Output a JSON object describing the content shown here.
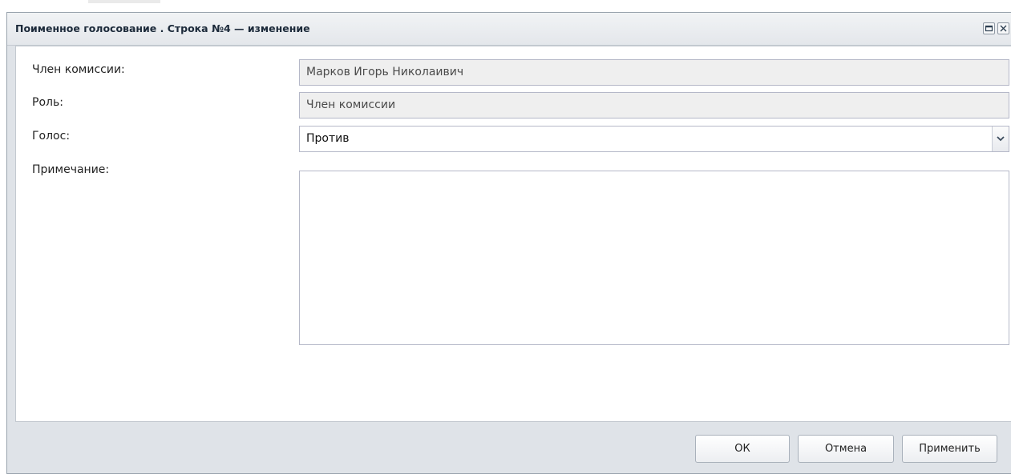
{
  "window": {
    "title": "Поименное голосование . Строка №4 — изменение"
  },
  "form": {
    "member": {
      "label": "Член комиссии:",
      "value": "Марков Игорь Николаивич"
    },
    "role": {
      "label": "Роль:",
      "value": "Член комиссии"
    },
    "vote": {
      "label": "Голос:",
      "value": "Против"
    },
    "note": {
      "label": "Примечание:",
      "value": ""
    }
  },
  "buttons": {
    "ok": "ОК",
    "cancel": "Отмена",
    "apply": "Применить"
  },
  "icons": {
    "maximize": "maximize-icon",
    "close": "close-icon",
    "dropdown": "chevron-down-icon"
  }
}
